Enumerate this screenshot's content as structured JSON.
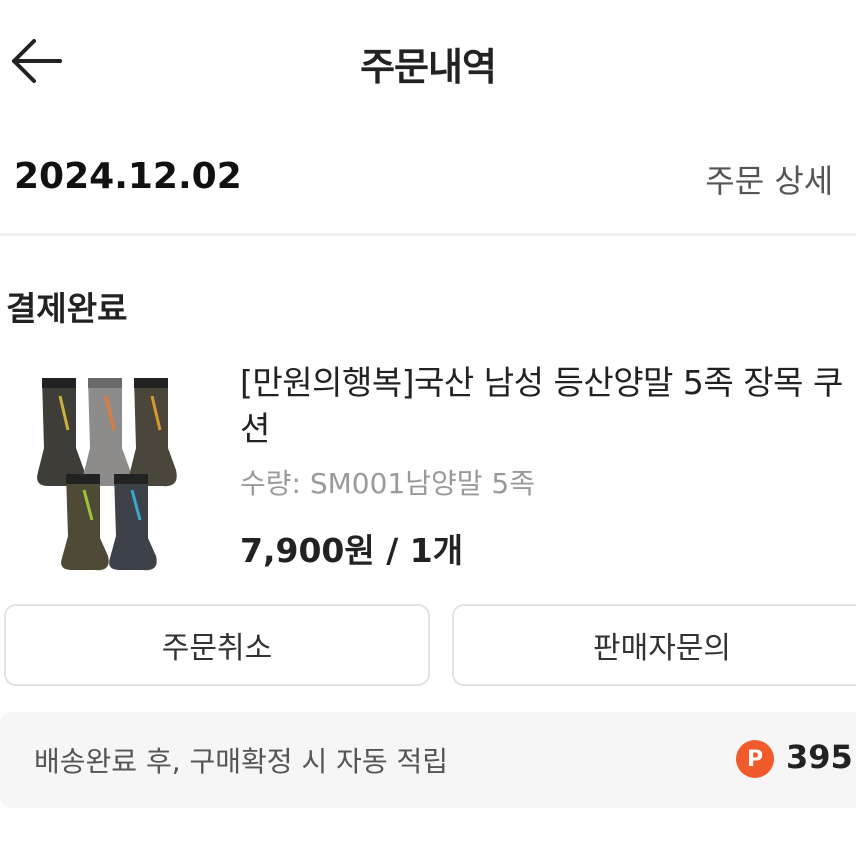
{
  "header": {
    "title": "주문내역",
    "back_icon": "arrow-left-icon"
  },
  "order": {
    "date": "2024.12.02",
    "detail_link": "주문 상세",
    "detail_chevron": "›",
    "status": "결제완료",
    "product": {
      "name": "[만원의행복]국산 남성 등산양말 5족 장목 쿠션",
      "option": "수량: SM001남양말 5족",
      "price": "7,900원 / 1개"
    }
  },
  "actions": {
    "cancel_label": "주문취소",
    "inquiry_label": "판매자문의"
  },
  "points": {
    "message": "배송완료 후, 구매확정 시 자동 적립",
    "badge": "P",
    "value": "395",
    "badge_color": "#f15a2b"
  }
}
